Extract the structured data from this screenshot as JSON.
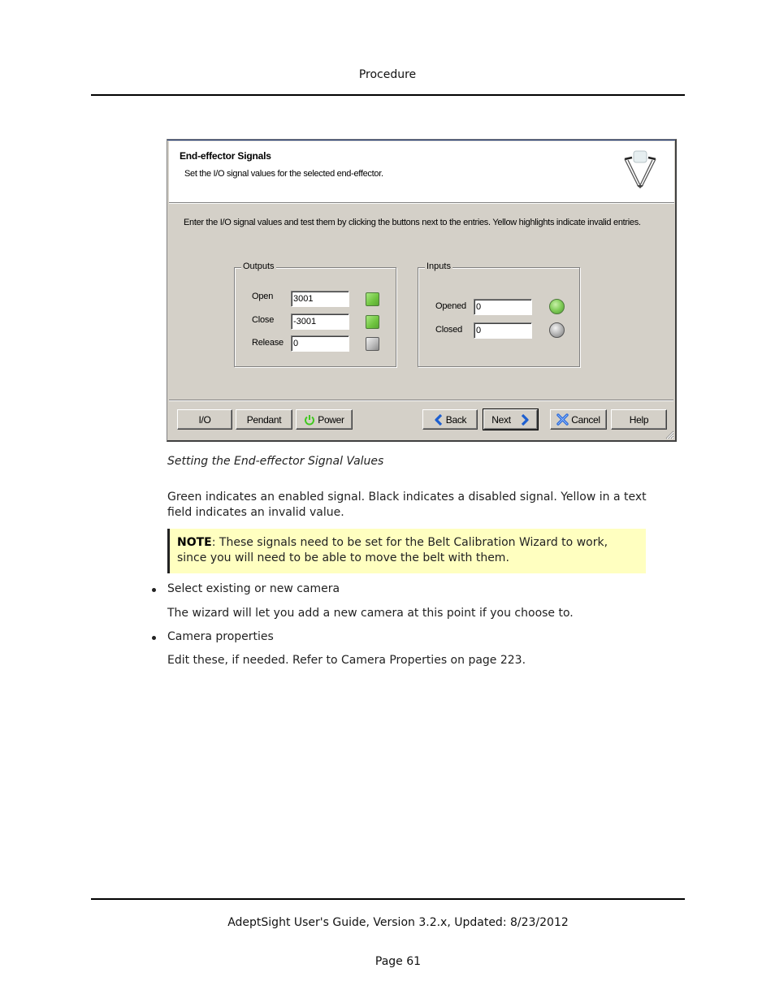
{
  "page": {
    "header": "Procedure",
    "footer_guide": "AdeptSight User's Guide,  Version 3.2.x, Updated: 8/23/2012",
    "footer_page": "Page 61"
  },
  "dialog": {
    "title": "End-effector Signals",
    "subtitle": "Set the I/O signal values for the selected end-effector.",
    "header_icon": "delta-robot-icon",
    "instructions": "Enter the I/O signal values and test them by clicking the buttons next to the entries.  Yellow highlights indicate invalid entries.",
    "outputs": {
      "legend": "Outputs",
      "rows": [
        {
          "label": "Open",
          "value": "3001",
          "state": "on"
        },
        {
          "label": "Close",
          "value": "-3001",
          "state": "on"
        },
        {
          "label": "Release",
          "value": "0",
          "state": "off"
        }
      ]
    },
    "inputs": {
      "legend": "Inputs",
      "rows": [
        {
          "label": "Opened",
          "value": "0",
          "state": "on"
        },
        {
          "label": "Closed",
          "value": "0",
          "state": "off"
        }
      ]
    },
    "buttons": {
      "io": "I/O",
      "pendant": "Pendant",
      "power": "Power",
      "back": "Back",
      "next": "Next",
      "cancel": "Cancel",
      "help": "Help"
    },
    "colors": {
      "led_on": "#6fc43f",
      "led_off": "#b8b8b8",
      "power_icon": "#3ec81e",
      "nav_arrow": "#1d5fd0"
    }
  },
  "content": {
    "caption": "Setting the End-effector Signal Values",
    "paragraph": "Green indicates an enabled signal. Black indicates a disabled signal. Yellow in a text field indicates an invalid value.",
    "note_label": "NOTE",
    "note_text": ": These signals need to be set for the Belt Calibration Wizard to work, since you will need to be able to move the belt with them.",
    "bullets": [
      {
        "title": "Select existing or new camera",
        "detail": "The wizard will let you add a new camera at this point if you choose to."
      },
      {
        "title": "Camera properties",
        "detail": "Edit these, if needed. Refer to Camera Properties on page 223."
      }
    ],
    "note_bg": "#ffffc0"
  }
}
